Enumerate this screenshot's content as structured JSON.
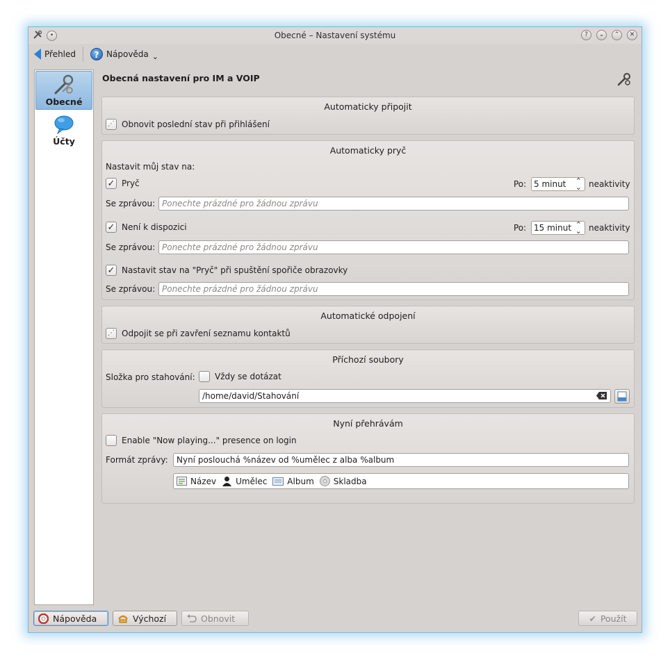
{
  "window": {
    "title": "Obecné – Nastavení systému"
  },
  "toolbar": {
    "back_label": "Přehled",
    "help_label": "Nápověda",
    "help_chevron": "⌄"
  },
  "sidebar": {
    "items": [
      {
        "label": "Obecné",
        "active": true,
        "icon": "wrench-tools-icon"
      },
      {
        "label": "Účty",
        "active": false,
        "icon": "speech-bubble-icon"
      }
    ]
  },
  "page": {
    "title": "Obecná nastavení pro IM a VOIP"
  },
  "auto_connect": {
    "title": "Automaticky připojit",
    "restore_label": "Obnovit poslední stav při přihlášení"
  },
  "auto_away": {
    "title": "Automaticky pryč",
    "set_status_label": "Nastavit můj stav na:",
    "away_label": "Pryč",
    "away_after_label": "Po:",
    "away_time": "5 minut",
    "inactivity_label": "neaktivity",
    "message_label": "Se zprávou:",
    "message_placeholder": "Ponechte prázdné pro žádnou zprávu",
    "na_label": "Není k dispozici",
    "na_time": "15 minut",
    "screensaver_label": "Nastavit stav na \"Pryč\" při spuštění spořiče obrazovky"
  },
  "auto_disconnect": {
    "title": "Automatické odpojení",
    "disconnect_label": "Odpojit se při zavření seznamu kontaktů"
  },
  "incoming_files": {
    "title": "Příchozí soubory",
    "folder_label": "Složka pro stahování:",
    "always_ask_label": "Vždy se dotázat",
    "path": "/home/david/Stahování"
  },
  "now_playing": {
    "title": "Nyní přehrávám",
    "enable_label": "Enable \"Now playing...\" presence on login",
    "format_label": "Formát zprávy:",
    "format_value": "Nyní poslouchá %název od %umělec z alba %album",
    "tokens": [
      "Název",
      "Umělec",
      "Album",
      "Skladba"
    ]
  },
  "buttons": {
    "help": "Nápověda",
    "defaults": "Výchozí",
    "reset": "Obnovit",
    "apply": "Použít"
  },
  "colors": {
    "accent": "#2e7fcf",
    "window_bg": "#d6d2d0"
  }
}
